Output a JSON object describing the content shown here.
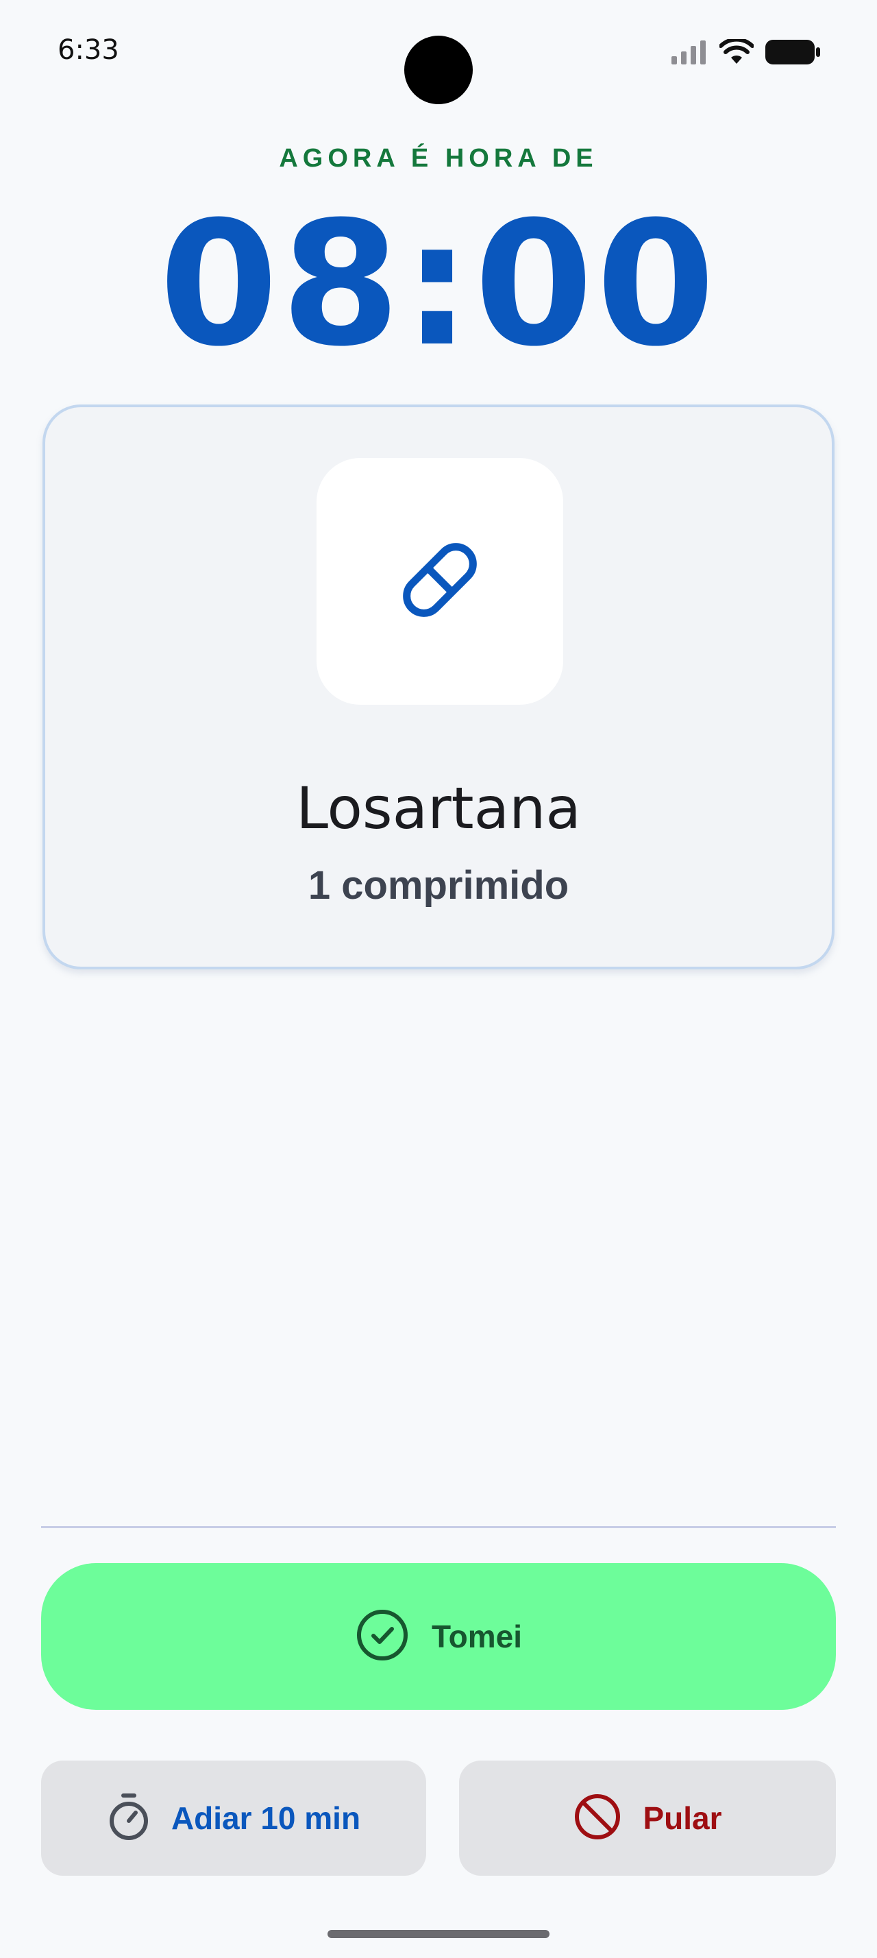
{
  "status_bar": {
    "time": "6:33",
    "icons": [
      "signal-icon",
      "wifi-icon",
      "battery-icon"
    ]
  },
  "header": {
    "now_label": "AGORA É HORA DE",
    "time": "08:00"
  },
  "medication": {
    "icon": "pill-icon",
    "name": "Losartana",
    "dose": "1 comprimido"
  },
  "actions": {
    "took": {
      "label": "Tomei",
      "icon": "check-circle-icon"
    },
    "snooze": {
      "label": "Adiar 10 min",
      "icon": "timer-icon"
    },
    "skip": {
      "label": "Pular",
      "icon": "block-icon"
    }
  },
  "colors": {
    "accent_blue": "#0a57bd",
    "green_label": "#14783c",
    "took_bg": "#6dfd9a",
    "skip_red": "#9e0e12"
  }
}
